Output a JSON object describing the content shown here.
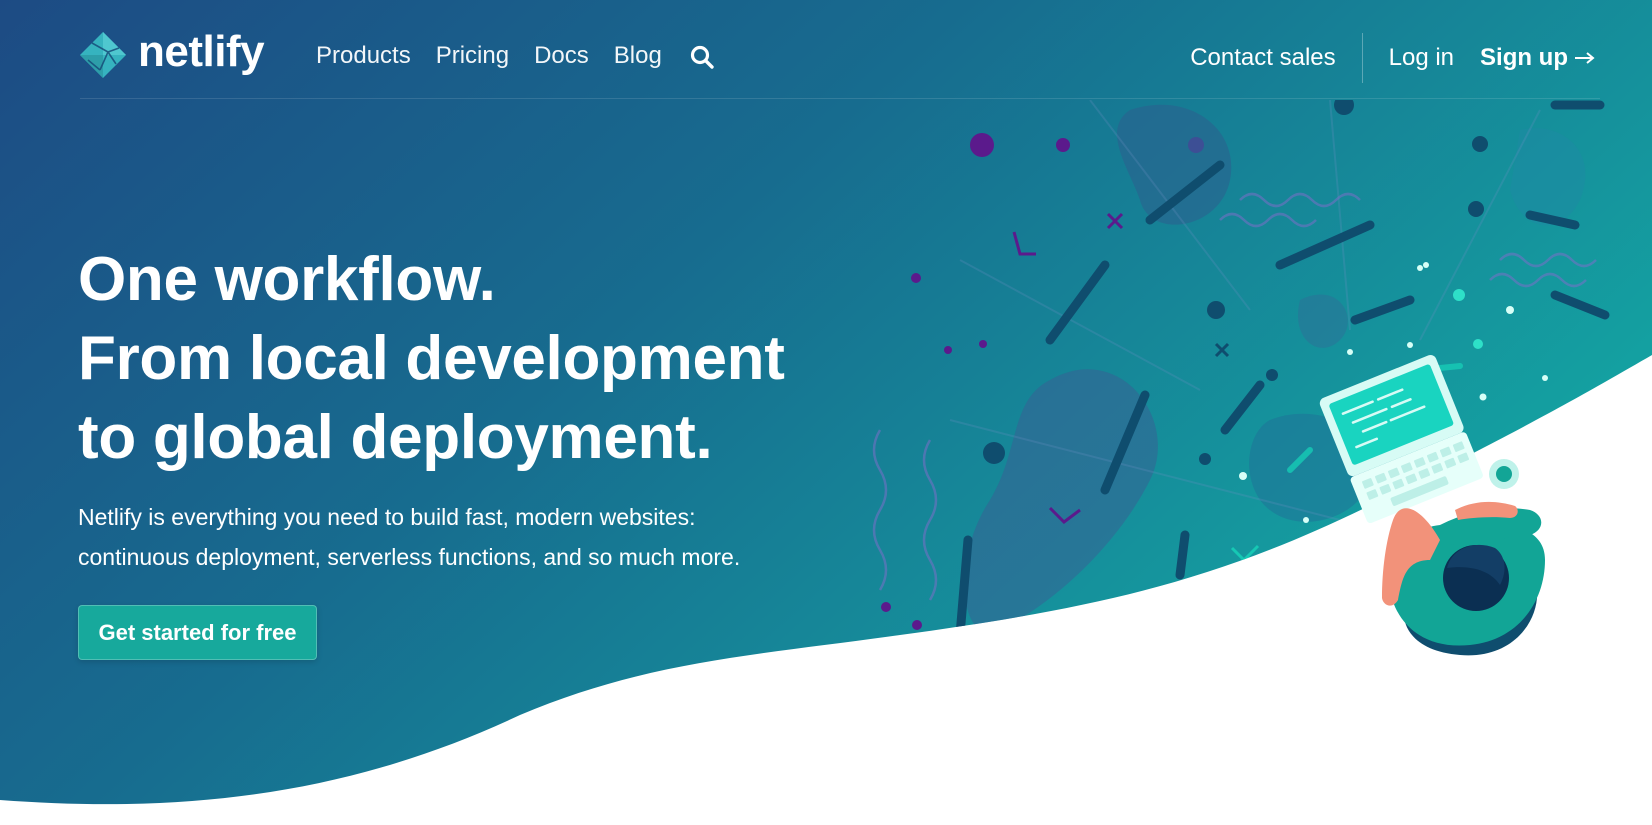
{
  "brand": {
    "name": "netlify",
    "logo_icon": "netlify-diamond-icon",
    "color_gradient_start": "#1d4e86",
    "color_gradient_end": "#14a2a2",
    "accent": "#17a99c"
  },
  "nav": {
    "items": [
      {
        "label": "Products"
      },
      {
        "label": "Pricing"
      },
      {
        "label": "Docs"
      },
      {
        "label": "Blog"
      }
    ],
    "search_icon": "search-icon",
    "contact_label": "Contact sales",
    "login_label": "Log in",
    "signup_label": "Sign up",
    "signup_icon": "arrow-right-icon"
  },
  "hero": {
    "headline_lines": [
      "One workflow.",
      "From local development",
      "to global deployment."
    ],
    "description_lines": [
      "Netlify is everything you need to build fast, modern websites:",
      "continuous deployment, serverless functions, and so much more."
    ],
    "cta_label": "Get started for free",
    "illustration_icon": "developer-laptop-illustration"
  }
}
